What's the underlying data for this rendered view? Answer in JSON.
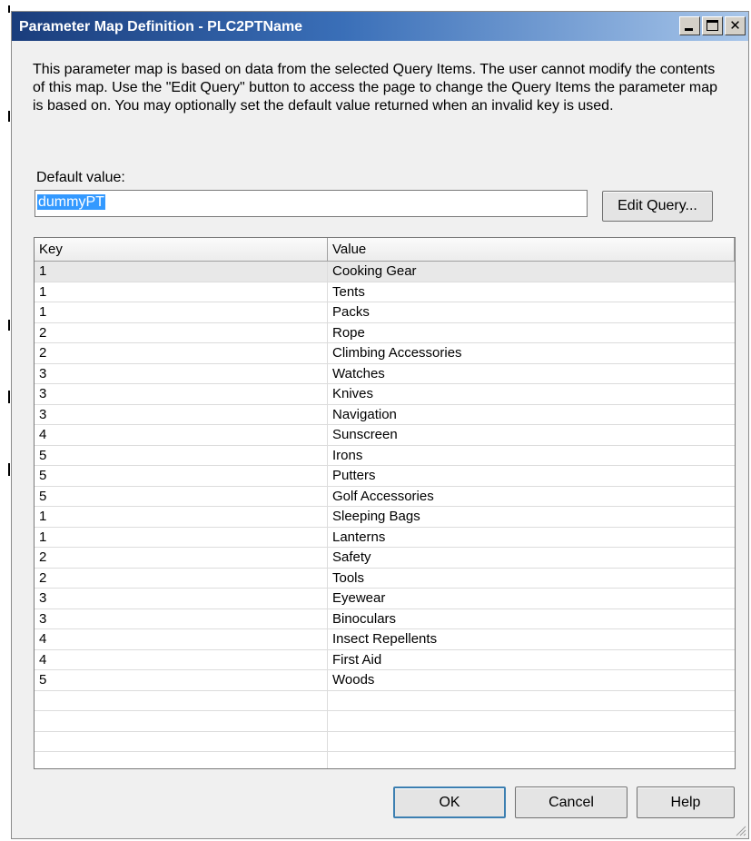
{
  "window": {
    "title": "Parameter Map Definition - PLC2PTName",
    "minimize_glyph": "minimize-icon",
    "maximize_glyph": "maximize-icon",
    "close_glyph": "✕"
  },
  "description": "This parameter map is based on data from the selected Query Items.  The user cannot modify the contents of this map.  Use the \"Edit Query\" button to access the page to change the Query Items the parameter map is based on.  You may optionally set the default value returned when an invalid key is used.",
  "default_value": {
    "label": "Default value:",
    "value": "dummyPT"
  },
  "buttons": {
    "edit_query": "Edit Query...",
    "ok": "OK",
    "cancel": "Cancel",
    "help": "Help"
  },
  "table": {
    "columns": [
      "Key",
      "Value"
    ],
    "rows": [
      {
        "key": "1",
        "value": "Cooking Gear"
      },
      {
        "key": "1",
        "value": "Tents"
      },
      {
        "key": "1",
        "value": "Packs"
      },
      {
        "key": "2",
        "value": "Rope"
      },
      {
        "key": "2",
        "value": "Climbing Accessories"
      },
      {
        "key": "3",
        "value": "Watches"
      },
      {
        "key": "3",
        "value": "Knives"
      },
      {
        "key": "3",
        "value": "Navigation"
      },
      {
        "key": "4",
        "value": "Sunscreen"
      },
      {
        "key": "5",
        "value": "Irons"
      },
      {
        "key": "5",
        "value": "Putters"
      },
      {
        "key": "5",
        "value": "Golf Accessories"
      },
      {
        "key": "1",
        "value": "Sleeping Bags"
      },
      {
        "key": "1",
        "value": "Lanterns"
      },
      {
        "key": "2",
        "value": "Safety"
      },
      {
        "key": "2",
        "value": "Tools"
      },
      {
        "key": "3",
        "value": "Eyewear"
      },
      {
        "key": "3",
        "value": "Binoculars"
      },
      {
        "key": "4",
        "value": "Insect Repellents"
      },
      {
        "key": "4",
        "value": "First Aid"
      },
      {
        "key": "5",
        "value": "Woods"
      },
      {
        "key": "",
        "value": ""
      },
      {
        "key": "",
        "value": ""
      },
      {
        "key": "",
        "value": ""
      },
      {
        "key": "",
        "value": ""
      }
    ]
  }
}
